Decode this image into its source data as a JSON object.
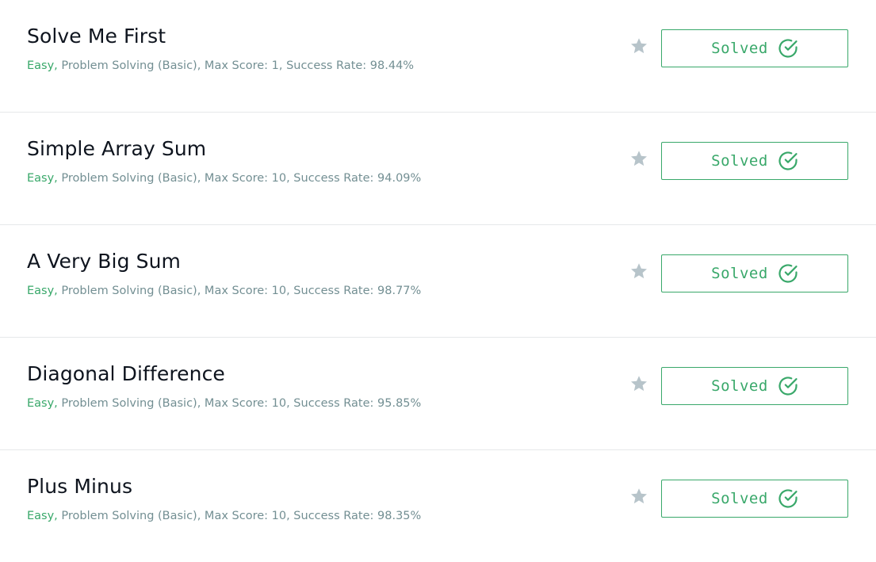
{
  "colors": {
    "accent_green": "#39a86a",
    "meta_gray": "#738f93",
    "title_dark": "#0e141e",
    "star_gray": "#b7c4ca"
  },
  "challenges": [
    {
      "title": "Solve Me First",
      "difficulty": "Easy,",
      "details": " Problem Solving (Basic), Max Score: 1, Success Rate: 98.44%",
      "status": "Solved",
      "icons": {
        "favorite": "star-icon",
        "status": "check-circle-icon"
      }
    },
    {
      "title": "Simple Array Sum",
      "difficulty": "Easy,",
      "details": " Problem Solving (Basic), Max Score: 10, Success Rate: 94.09%",
      "status": "Solved",
      "icons": {
        "favorite": "star-icon",
        "status": "check-circle-icon"
      }
    },
    {
      "title": "A Very Big Sum",
      "difficulty": "Easy,",
      "details": " Problem Solving (Basic), Max Score: 10, Success Rate: 98.77%",
      "status": "Solved",
      "icons": {
        "favorite": "star-icon",
        "status": "check-circle-icon"
      }
    },
    {
      "title": "Diagonal Difference",
      "difficulty": "Easy,",
      "details": " Problem Solving (Basic), Max Score: 10, Success Rate: 95.85%",
      "status": "Solved",
      "icons": {
        "favorite": "star-icon",
        "status": "check-circle-icon"
      }
    },
    {
      "title": "Plus Minus",
      "difficulty": "Easy,",
      "details": " Problem Solving (Basic), Max Score: 10, Success Rate: 98.35%",
      "status": "Solved",
      "icons": {
        "favorite": "star-icon",
        "status": "check-circle-icon"
      }
    }
  ]
}
